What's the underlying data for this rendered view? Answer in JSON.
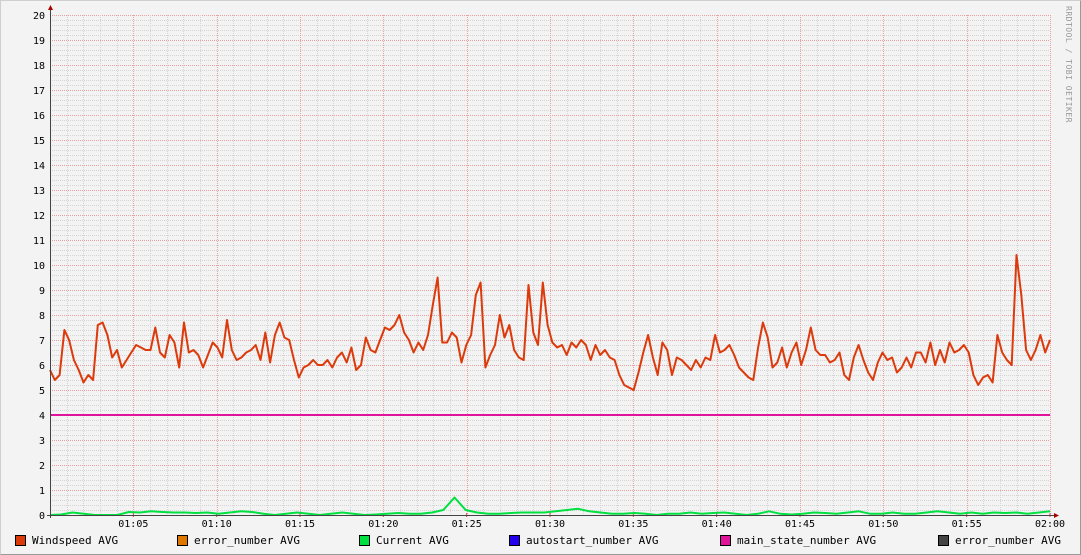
{
  "watermark": "RRDTOOL / TOBI OETIKER",
  "chart_data": {
    "type": "line",
    "title": "",
    "xlabel": "",
    "ylabel": "",
    "x_range": [
      "01:00",
      "02:00"
    ],
    "x_ticks": [
      "01:05",
      "01:10",
      "01:15",
      "01:20",
      "01:25",
      "01:30",
      "01:35",
      "01:40",
      "01:45",
      "01:50",
      "01:55",
      "02:00"
    ],
    "ylim": [
      0,
      20
    ],
    "y_ticks": [
      0,
      1,
      2,
      3,
      4,
      5,
      6,
      7,
      8,
      9,
      10,
      11,
      12,
      13,
      14,
      15,
      16,
      17,
      18,
      19,
      20
    ],
    "grid": true,
    "legend_position": "bottom",
    "series": [
      {
        "name": "Windspeed AVG",
        "color": "#dd3a0c",
        "values": [
          5.8,
          5.4,
          5.6,
          7.4,
          7.0,
          6.2,
          5.8,
          5.3,
          5.6,
          5.4,
          7.6,
          7.7,
          7.2,
          6.3,
          6.6,
          5.9,
          6.2,
          6.5,
          6.8,
          6.7,
          6.6,
          6.6,
          7.5,
          6.5,
          6.3,
          7.2,
          6.9,
          5.9,
          7.7,
          6.5,
          6.6,
          6.4,
          5.9,
          6.4,
          6.9,
          6.7,
          6.3,
          7.8,
          6.6,
          6.2,
          6.3,
          6.5,
          6.6,
          6.8,
          6.2,
          7.3,
          6.1,
          7.2,
          7.7,
          7.1,
          7.0,
          6.2,
          5.5,
          5.9,
          6.0,
          6.2,
          6.0,
          6.0,
          6.2,
          5.9,
          6.3,
          6.5,
          6.1,
          6.7,
          5.8,
          6.0,
          7.1,
          6.6,
          6.5,
          7.0,
          7.5,
          7.4,
          7.6,
          8.0,
          7.3,
          7.0,
          6.5,
          6.9,
          6.6,
          7.2,
          8.4,
          9.5,
          6.9,
          6.9,
          7.3,
          7.1,
          6.1,
          6.8,
          7.2,
          8.8,
          9.3,
          5.9,
          6.4,
          6.8,
          8.0,
          7.1,
          7.6,
          6.6,
          6.3,
          6.2,
          9.2,
          7.3,
          6.8,
          9.3,
          7.6,
          6.9,
          6.7,
          6.8,
          6.4,
          6.9,
          6.7,
          7.0,
          6.8,
          6.2,
          6.8,
          6.4,
          6.6,
          6.3,
          6.2,
          5.6,
          5.2,
          5.1,
          5.0,
          5.7,
          6.5,
          7.2,
          6.3,
          5.6,
          6.9,
          6.6,
          5.6,
          6.3,
          6.2,
          6.0,
          5.8,
          6.2,
          5.9,
          6.3,
          6.2,
          7.2,
          6.5,
          6.6,
          6.8,
          6.4,
          5.9,
          5.7,
          5.5,
          5.4,
          6.7,
          7.7,
          7.1,
          5.9,
          6.1,
          6.7,
          5.9,
          6.5,
          6.9,
          6.0,
          6.6,
          7.5,
          6.6,
          6.4,
          6.4,
          6.1,
          6.2,
          6.5,
          5.6,
          5.4,
          6.3,
          6.8,
          6.2,
          5.7,
          5.4,
          6.1,
          6.5,
          6.2,
          6.3,
          5.7,
          5.9,
          6.3,
          5.9,
          6.5,
          6.5,
          6.1,
          6.9,
          6.0,
          6.6,
          6.1,
          6.9,
          6.5,
          6.6,
          6.8,
          6.5,
          5.6,
          5.2,
          5.5,
          5.6,
          5.3,
          7.2,
          6.5,
          6.2,
          6.0,
          10.4,
          8.8,
          6.6,
          6.2,
          6.6,
          7.2,
          6.5,
          7.0
        ]
      },
      {
        "name": "error_number AVG",
        "color": "#e07800",
        "values": [
          0,
          0
        ]
      },
      {
        "name": "Current AVG",
        "color": "#00e040",
        "values": [
          0,
          0.02,
          0.1,
          0.05,
          0,
          0,
          0,
          0.12,
          0.1,
          0.15,
          0.12,
          0.1,
          0.1,
          0.08,
          0.1,
          0.05,
          0.1,
          0.15,
          0.12,
          0.05,
          0,
          0.05,
          0.1,
          0.05,
          0,
          0.05,
          0.1,
          0.05,
          0,
          0.02,
          0.05,
          0.08,
          0.05,
          0.05,
          0.1,
          0.2,
          0.7,
          0.2,
          0.1,
          0.05,
          0.05,
          0.08,
          0.1,
          0.1,
          0.1,
          0.15,
          0.2,
          0.25,
          0.15,
          0.1,
          0.05,
          0.05,
          0.08,
          0.05,
          0,
          0.05,
          0.05,
          0.1,
          0.05,
          0.08,
          0.1,
          0.05,
          0,
          0.05,
          0.15,
          0.05,
          0.02,
          0.05,
          0.1,
          0.08,
          0.05,
          0.1,
          0.15,
          0.05,
          0.05,
          0.1,
          0.05,
          0.05,
          0.1,
          0.15,
          0.1,
          0.05,
          0.1,
          0.05,
          0.1,
          0.08,
          0.1,
          0.05,
          0.1,
          0.15
        ]
      },
      {
        "name": "autostart_number AVG",
        "color": "#2200ee",
        "values": [
          0,
          0
        ]
      },
      {
        "name": "main_state_number AVG",
        "color": "#e0149a",
        "values": [
          4,
          4
        ]
      },
      {
        "name": "error_number AVG",
        "color": "#444444",
        "values": [
          0,
          0
        ]
      }
    ]
  }
}
